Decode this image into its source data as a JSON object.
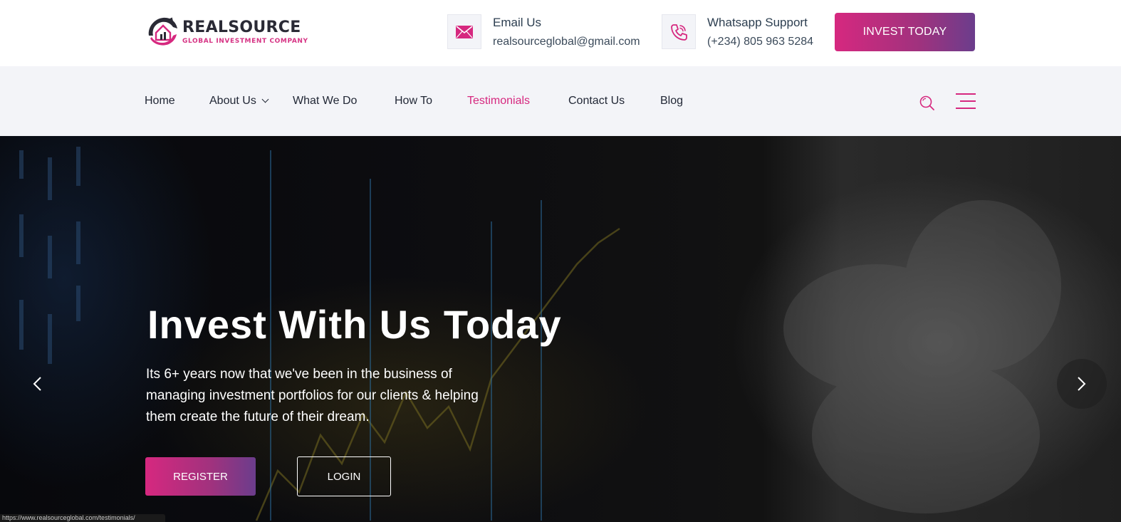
{
  "brand": {
    "name": "REALSOURCE",
    "tagline": "GLOBAL INVESTMENT COMPANY",
    "accent_color": "#d6287f",
    "gradient_end_color": "#6b3d8c"
  },
  "header": {
    "email": {
      "icon": "envelope-icon",
      "title": "Email Us",
      "value": "realsourceglobal@gmail.com"
    },
    "phone": {
      "icon": "phone-icon",
      "title": "Whatsapp Support",
      "value": "(+234) 805 963 5284"
    },
    "cta_label": "INVEST TODAY"
  },
  "nav": {
    "items": [
      {
        "label": "Home",
        "active": false,
        "has_dropdown": false
      },
      {
        "label": "About Us",
        "active": false,
        "has_dropdown": true
      },
      {
        "label": "What We Do",
        "active": false,
        "has_dropdown": false
      },
      {
        "label": "How To",
        "active": false,
        "has_dropdown": false
      },
      {
        "label": "Testimonials",
        "active": true,
        "has_dropdown": false
      },
      {
        "label": "Contact Us",
        "active": false,
        "has_dropdown": false
      },
      {
        "label": "Blog",
        "active": false,
        "has_dropdown": false
      }
    ],
    "search_icon": "search-icon",
    "menu_icon": "hamburger-menu-icon"
  },
  "hero": {
    "title": "Invest With Us Today",
    "text": "Its 6+ years now that we've been in the business of managing investment portfolios for our clients & helping them create the future of their dream.",
    "register_label": "REGISTER",
    "login_label": "LOGIN",
    "prev_icon": "chevron-left-icon",
    "next_icon": "chevron-right-icon"
  },
  "status_bar": {
    "url": "https://www.realsourceglobal.com/testimonials/"
  }
}
